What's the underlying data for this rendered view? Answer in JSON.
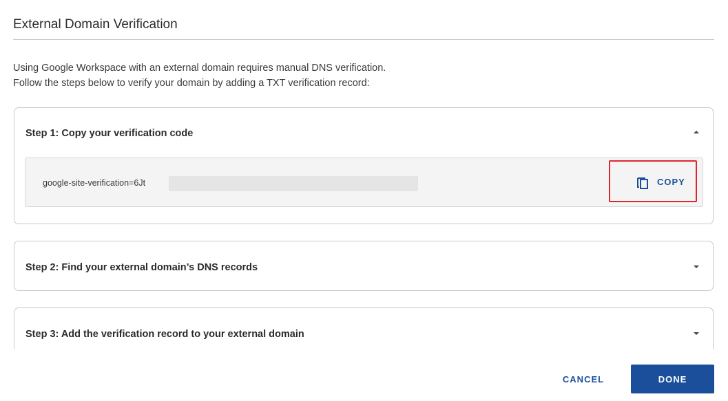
{
  "dialog": {
    "title": "External Domain Verification",
    "intro_line1": "Using Google Workspace with an external domain requires manual DNS verification.",
    "intro_line2": "Follow the steps below to verify your domain by adding a TXT verification record:"
  },
  "steps": [
    {
      "title": "Step 1: Copy your verification code",
      "expanded": true,
      "chevron_icon": "chevron-up-icon",
      "code": "google-site-verification=6Jt",
      "copy_label": "COPY",
      "copy_icon": "copy-icon"
    },
    {
      "title": "Step 2: Find your external domain’s DNS records",
      "expanded": false,
      "chevron_icon": "chevron-down-icon"
    },
    {
      "title": "Step 3: Add the verification record to your external domain",
      "expanded": false,
      "chevron_icon": "chevron-down-icon"
    }
  ],
  "footer": {
    "cancel_label": "CANCEL",
    "done_label": "DONE"
  },
  "colors": {
    "accent": "#1b4f9c",
    "highlight": "#e0262d"
  }
}
